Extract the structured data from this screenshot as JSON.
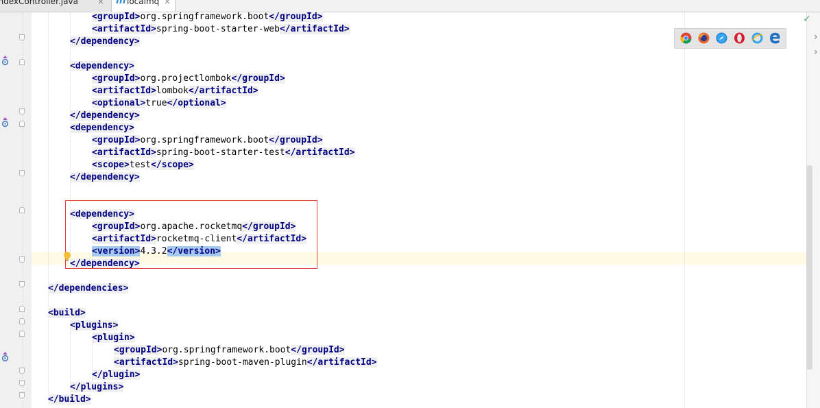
{
  "tabs": [
    {
      "label": "IndexController.java",
      "close": "×",
      "icon": "java-file-icon"
    },
    {
      "label": "localmq",
      "close": "×",
      "icon": "maven-m-icon",
      "icon_glyph": "m",
      "active": true
    }
  ],
  "browser_icons": [
    "chrome-icon",
    "firefox-icon",
    "safari-icon",
    "opera-icon",
    "ie-icon",
    "edge-icon"
  ],
  "colors": {
    "tag": "#000080",
    "tag_bg": "#efefef",
    "selection": "#a6c9ef",
    "current_line": "#fffae3",
    "highlight_box": "#e23b3b"
  },
  "editor": {
    "lines": [
      {
        "indent": 2,
        "parts": [
          {
            "t": "tg",
            "v": "<groupId>"
          },
          {
            "t": "tx",
            "v": "org.springframework.boot"
          },
          {
            "t": "tg",
            "v": "</groupId>"
          }
        ]
      },
      {
        "indent": 2,
        "parts": [
          {
            "t": "tg",
            "v": "<artifactId>"
          },
          {
            "t": "tx",
            "v": "spring-boot-starter-web"
          },
          {
            "t": "tg",
            "v": "</artifactId>"
          }
        ]
      },
      {
        "indent": 1,
        "parts": [
          {
            "t": "tg",
            "v": "</dependency>"
          }
        ]
      },
      {
        "indent": 0,
        "parts": []
      },
      {
        "indent": 1,
        "parts": [
          {
            "t": "tg",
            "v": "<dependency>"
          }
        ]
      },
      {
        "indent": 2,
        "parts": [
          {
            "t": "tg",
            "v": "<groupId>"
          },
          {
            "t": "tx",
            "v": "org.projectlombok"
          },
          {
            "t": "tg",
            "v": "</groupId>"
          }
        ]
      },
      {
        "indent": 2,
        "parts": [
          {
            "t": "tg",
            "v": "<artifactId>"
          },
          {
            "t": "tx",
            "v": "lombok"
          },
          {
            "t": "tg",
            "v": "</artifactId>"
          }
        ]
      },
      {
        "indent": 2,
        "parts": [
          {
            "t": "tg",
            "v": "<optional>"
          },
          {
            "t": "tx",
            "v": "true"
          },
          {
            "t": "tg",
            "v": "</optional>"
          }
        ]
      },
      {
        "indent": 1,
        "parts": [
          {
            "t": "tg",
            "v": "</dependency>"
          }
        ]
      },
      {
        "indent": 1,
        "parts": [
          {
            "t": "tg",
            "v": "<dependency>"
          }
        ]
      },
      {
        "indent": 2,
        "parts": [
          {
            "t": "tg",
            "v": "<groupId>"
          },
          {
            "t": "tx",
            "v": "org.springframework.boot"
          },
          {
            "t": "tg",
            "v": "</groupId>"
          }
        ]
      },
      {
        "indent": 2,
        "parts": [
          {
            "t": "tg",
            "v": "<artifactId>"
          },
          {
            "t": "tx",
            "v": "spring-boot-starter-test"
          },
          {
            "t": "tg",
            "v": "</artifactId>"
          }
        ]
      },
      {
        "indent": 2,
        "parts": [
          {
            "t": "tg",
            "v": "<scope>"
          },
          {
            "t": "tx",
            "v": "test"
          },
          {
            "t": "tg",
            "v": "</scope>"
          }
        ]
      },
      {
        "indent": 1,
        "parts": [
          {
            "t": "tg",
            "v": "</dependency>"
          }
        ]
      },
      {
        "indent": 0,
        "parts": []
      },
      {
        "indent": 0,
        "parts": []
      },
      {
        "indent": 1,
        "parts": [
          {
            "t": "tg",
            "v": "<dependency>"
          }
        ]
      },
      {
        "indent": 2,
        "parts": [
          {
            "t": "tg",
            "v": "<groupId>"
          },
          {
            "t": "tx",
            "v": "org.apache.rocketmq"
          },
          {
            "t": "tg",
            "v": "</groupId>"
          }
        ]
      },
      {
        "indent": 2,
        "parts": [
          {
            "t": "tg",
            "v": "<artifactId>"
          },
          {
            "t": "tx",
            "v": "rocketmq-client"
          },
          {
            "t": "tg",
            "v": "</artifactId>"
          }
        ]
      },
      {
        "indent": 2,
        "parts": [
          {
            "t": "tgs",
            "v": "<version>"
          },
          {
            "t": "tx",
            "v": "4.3.2"
          },
          {
            "t": "tgs",
            "v": "</version>"
          }
        ]
      },
      {
        "indent": 1,
        "parts": [
          {
            "t": "tg",
            "v": "</dependency>"
          }
        ]
      },
      {
        "indent": 0,
        "parts": []
      },
      {
        "indent": 0,
        "parts": [
          {
            "t": "tg",
            "v": "</dependencies>"
          }
        ]
      },
      {
        "indent": 0,
        "parts": []
      },
      {
        "indent": 0,
        "parts": [
          {
            "t": "tg",
            "v": "<build>"
          }
        ]
      },
      {
        "indent": 1,
        "parts": [
          {
            "t": "tg",
            "v": "<plugins>"
          }
        ]
      },
      {
        "indent": 2,
        "parts": [
          {
            "t": "tg",
            "v": "<plugin>"
          }
        ]
      },
      {
        "indent": 3,
        "parts": [
          {
            "t": "tg",
            "v": "<groupId>"
          },
          {
            "t": "tx",
            "v": "org.springframework.boot"
          },
          {
            "t": "tg",
            "v": "</groupId>"
          }
        ]
      },
      {
        "indent": 3,
        "parts": [
          {
            "t": "tg",
            "v": "<artifactId>"
          },
          {
            "t": "tx",
            "v": "spring-boot-maven-plugin"
          },
          {
            "t": "tg",
            "v": "</artifactId>"
          }
        ]
      },
      {
        "indent": 2,
        "parts": [
          {
            "t": "tg",
            "v": "</plugin>"
          }
        ]
      },
      {
        "indent": 1,
        "parts": [
          {
            "t": "tg",
            "v": "</plugins>"
          }
        ]
      },
      {
        "indent": 0,
        "parts": [
          {
            "t": "tg",
            "v": "</build>"
          }
        ]
      }
    ]
  }
}
